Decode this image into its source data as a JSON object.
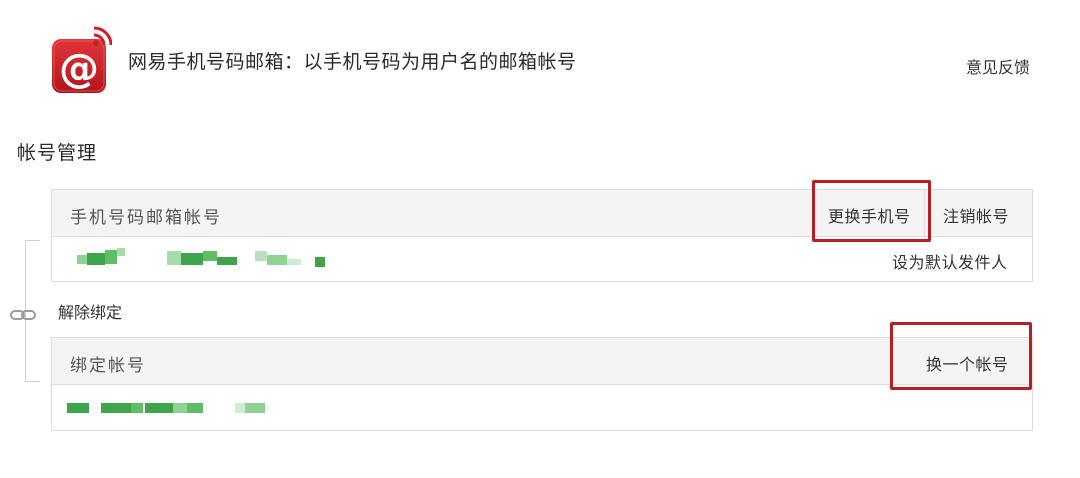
{
  "header": {
    "logo_icon": "at-sign-mail-icon",
    "title": "网易手机号码邮箱：以手机号码为用户名的邮箱帐号",
    "feedback_link": "意见反馈"
  },
  "section_title": "帐号管理",
  "mobile_account": {
    "label": "手机号码邮箱帐号",
    "change_phone": "更换手机号",
    "cancel_account": "注销帐号",
    "set_default_sender": "设为默认发件人"
  },
  "binding": {
    "link_icon": "chain-link-icon",
    "unbind_link": "解除绑定",
    "label": "绑定帐号",
    "switch_account": "换一个帐号"
  },
  "colors": {
    "brand_red": "#cc1f26",
    "highlight": "#b81f25",
    "pixelated": "#3ea54a"
  }
}
